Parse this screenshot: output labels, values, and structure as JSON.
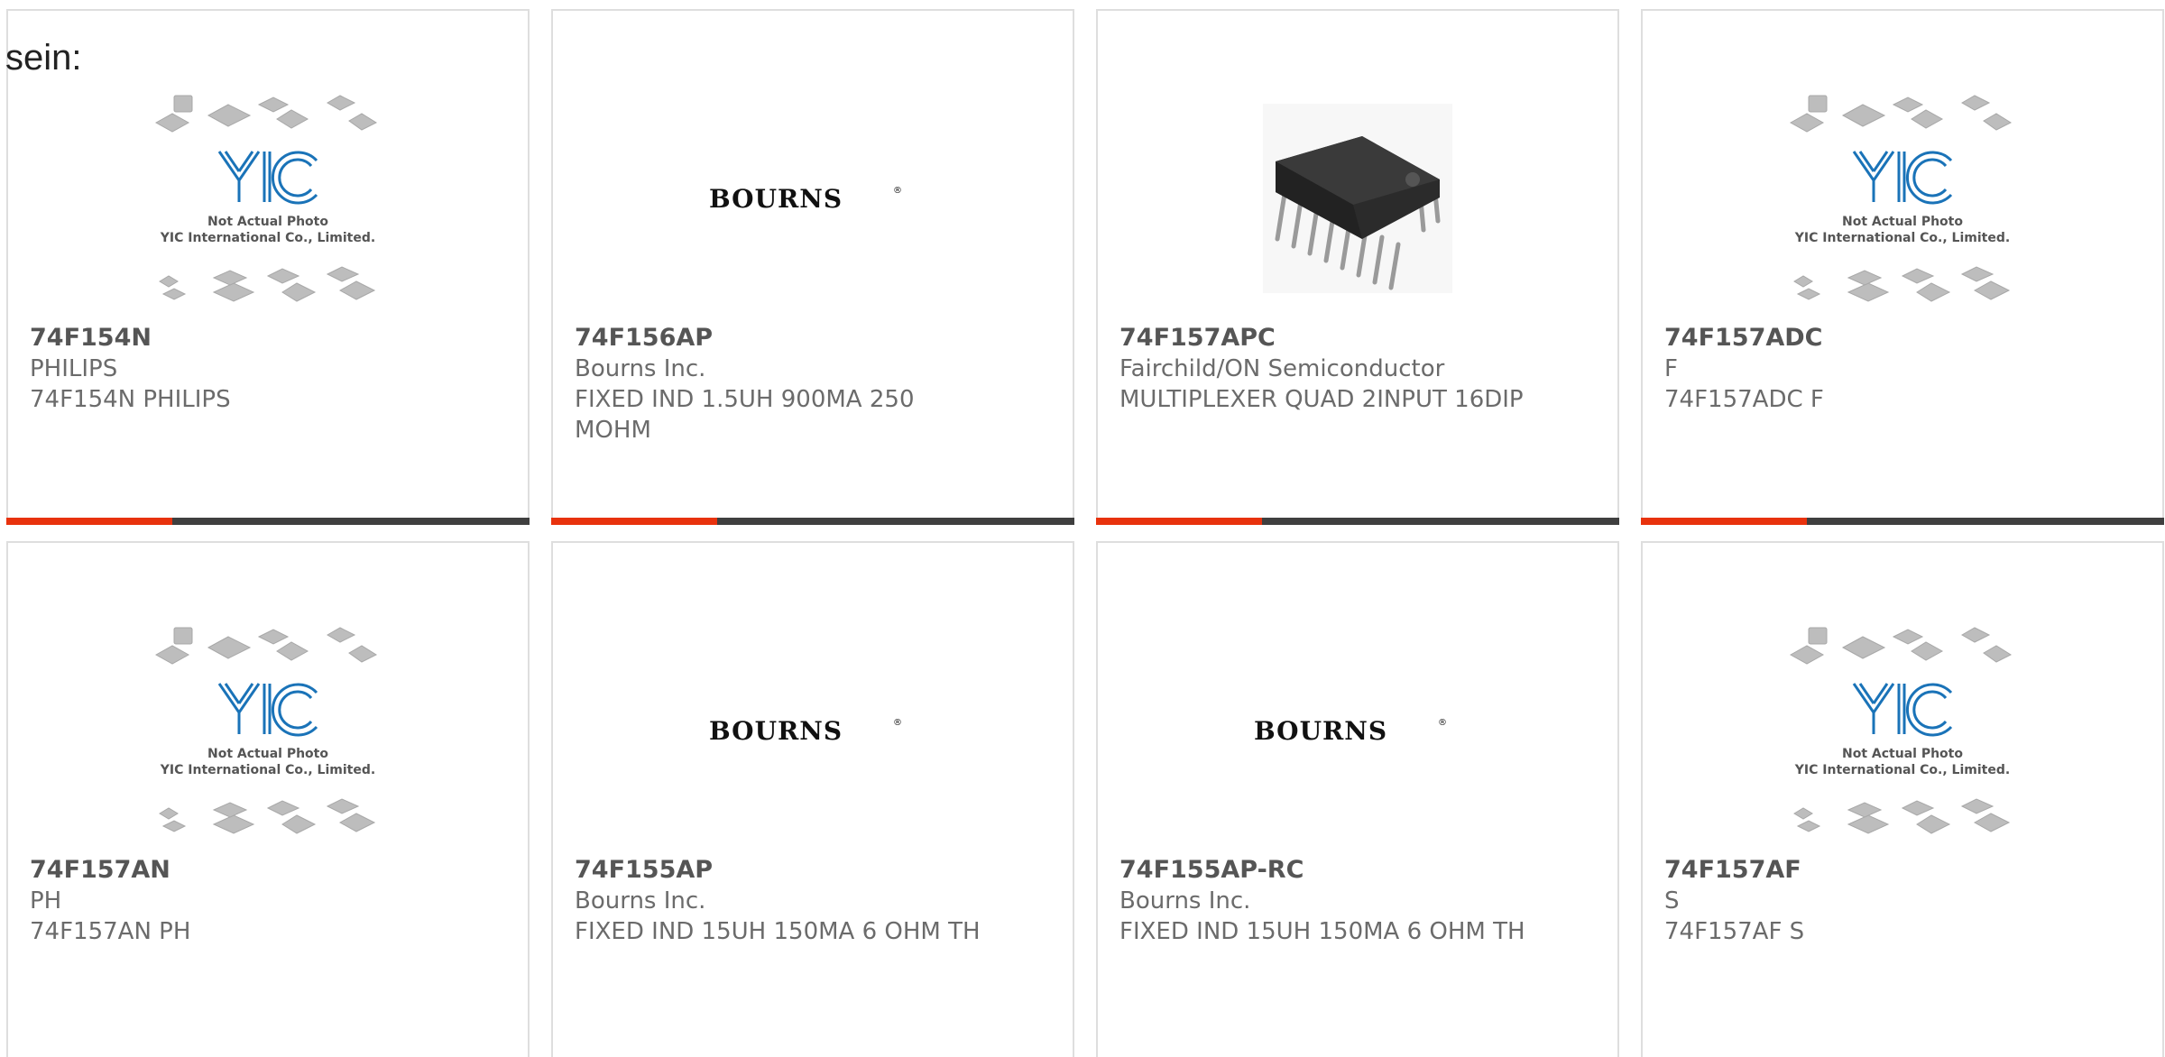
{
  "page": {
    "heading": "sein:"
  },
  "products": [
    {
      "part_number": "74F154N",
      "manufacturer": "PHILIPS",
      "description": "74F154N PHILIPS",
      "image": "yic-not-actual-photo",
      "image_lines": [
        "Not Actual Photo",
        "YIC International Co., Limited."
      ],
      "logo_text": "YIC"
    },
    {
      "part_number": "74F156AP",
      "manufacturer": "Bourns Inc.",
      "description": "FIXED IND 1.5UH 900MA 250 MOHM",
      "image": "bourns-logo",
      "logo_text": "BOURNS"
    },
    {
      "part_number": "74F157APC",
      "manufacturer": "Fairchild/ON Semiconductor",
      "description": "MULTIPLEXER QUAD 2INPUT 16DIP",
      "image": "dip-chip-photo"
    },
    {
      "part_number": "74F157ADC",
      "manufacturer": "F",
      "description": "74F157ADC F",
      "image": "yic-not-actual-photo",
      "image_lines": [
        "Not Actual Photo",
        "YIC International Co., Limited."
      ],
      "logo_text": "YIC"
    },
    {
      "part_number": "74F157AN",
      "manufacturer": "PH",
      "description": "74F157AN PH",
      "image": "yic-not-actual-photo",
      "image_lines": [
        "Not Actual Photo",
        "YIC International Co., Limited."
      ],
      "logo_text": "YIC"
    },
    {
      "part_number": "74F155AP",
      "manufacturer": "Bourns Inc.",
      "description": "FIXED IND 15UH 150MA 6 OHM TH",
      "image": "bourns-logo",
      "logo_text": "BOURNS"
    },
    {
      "part_number": "74F155AP-RC",
      "manufacturer": "Bourns Inc.",
      "description": "FIXED IND 15UH 150MA 6 OHM TH",
      "image": "bourns-logo",
      "logo_text": "BOURNS"
    },
    {
      "part_number": "74F157AF",
      "manufacturer": "S",
      "description": "74F157AF S",
      "image": "yic-not-actual-photo",
      "image_lines": [
        "Not Actual Photo",
        "YIC International Co., Limited."
      ],
      "logo_text": "YIC"
    }
  ],
  "colors": {
    "accent": "#e8320d",
    "bar": "#3f3f3f",
    "yic_blue": "#1a73b8",
    "text": "#6b6b6b"
  }
}
